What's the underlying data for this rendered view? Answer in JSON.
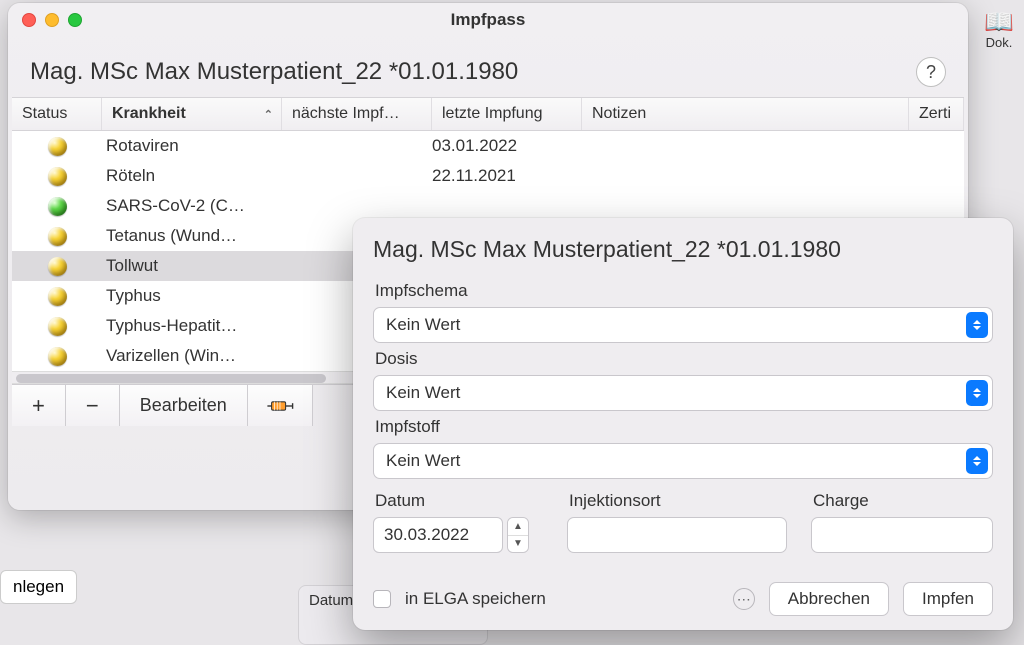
{
  "bg": {
    "dok": "Dok.",
    "nlegen": "nlegen",
    "datum_label": "Datum"
  },
  "window": {
    "title": "Impfpass",
    "patient": "Mag. MSc Max Musterpatient_22 *01.01.1980",
    "help": "?",
    "columns": {
      "status": "Status",
      "krankheit": "Krankheit",
      "next": "nächste Impf…",
      "last": "letzte Impfung",
      "notes": "Notizen",
      "zert": "Zerti"
    },
    "rows": [
      {
        "orb": "o-yellow",
        "krank": "Rotaviren",
        "last": "03.01.2022",
        "sel": false
      },
      {
        "orb": "o-yellow",
        "krank": "Röteln",
        "last": "22.11.2021",
        "sel": false
      },
      {
        "orb": "o-green",
        "krank": "SARS-CoV-2 (C…",
        "last": "",
        "sel": false
      },
      {
        "orb": "o-yellow",
        "krank": "Tetanus (Wund…",
        "last": "",
        "sel": false
      },
      {
        "orb": "o-yellow",
        "krank": "Tollwut",
        "last": "",
        "sel": true
      },
      {
        "orb": "o-yellow",
        "krank": "Typhus",
        "last": "",
        "sel": false
      },
      {
        "orb": "o-yellow",
        "krank": "Typhus-Hepatit…",
        "last": "",
        "sel": false
      },
      {
        "orb": "o-yellow",
        "krank": "Varizellen (Win…",
        "last": "",
        "sel": false
      }
    ],
    "toolbar": {
      "plus": "+",
      "minus": "−",
      "edit": "Bearbeiten"
    }
  },
  "sheet": {
    "title": "Mag. MSc Max Musterpatient_22 *01.01.1980",
    "schema_label": "Impfschema",
    "schema_value": "Kein Wert",
    "dosis_label": "Dosis",
    "dosis_value": "Kein Wert",
    "impfstoff_label": "Impfstoff",
    "impfstoff_value": "Kein Wert",
    "datum_label": "Datum",
    "datum_value": "30.03.2022",
    "inj_label": "Injektionsort",
    "charge_label": "Charge",
    "elga_label": "in ELGA speichern",
    "cancel": "Abbrechen",
    "confirm": "Impfen"
  }
}
